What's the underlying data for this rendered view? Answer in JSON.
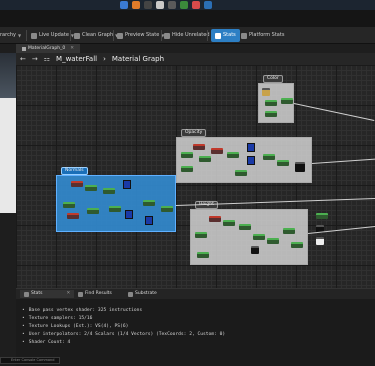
{
  "toolbar": {
    "items": [
      {
        "label": "rarchy",
        "name": "hierarchy-button"
      },
      {
        "label": "Live Update",
        "name": "live-update-button"
      },
      {
        "label": "Clean Graph",
        "name": "clean-graph-button"
      },
      {
        "label": "Preview State",
        "name": "preview-state-button"
      },
      {
        "label": "Hide Unrelated",
        "name": "hide-unrelated-button"
      },
      {
        "label": "Stats",
        "name": "stats-button"
      },
      {
        "label": "Platform Stats",
        "name": "platform-stats-button"
      }
    ]
  },
  "tab": {
    "label": "MaterialGraph_0"
  },
  "breadcrumb": {
    "path": "M_waterFall",
    "separator": "›",
    "graph": "Material Graph"
  },
  "graph": {
    "comments": [
      {
        "title": "Color"
      },
      {
        "title": "Opacity"
      },
      {
        "title": "Normals"
      },
      {
        "title": "Height"
      }
    ]
  },
  "bottom": {
    "tabs": [
      {
        "label": "Stats"
      },
      {
        "label": "Find Results"
      },
      {
        "label": "Substrate"
      }
    ],
    "stats": [
      "Base pass vertex shader: 325 instructions",
      "Texture samplers: 15/16",
      "Texture Lookups (Est.): VS(4), PS(6)",
      "User interpolators: 2/4 Scalars (1/4 Vectors) (TexCoords: 2, Custom: 0)",
      "Shader Count: 4"
    ]
  },
  "console": {
    "placeholder": "Enter Console Command"
  },
  "colors": {
    "accent": "#2d7fc4",
    "comment_blue": "#338cd2",
    "graph_bg": "#262626"
  }
}
